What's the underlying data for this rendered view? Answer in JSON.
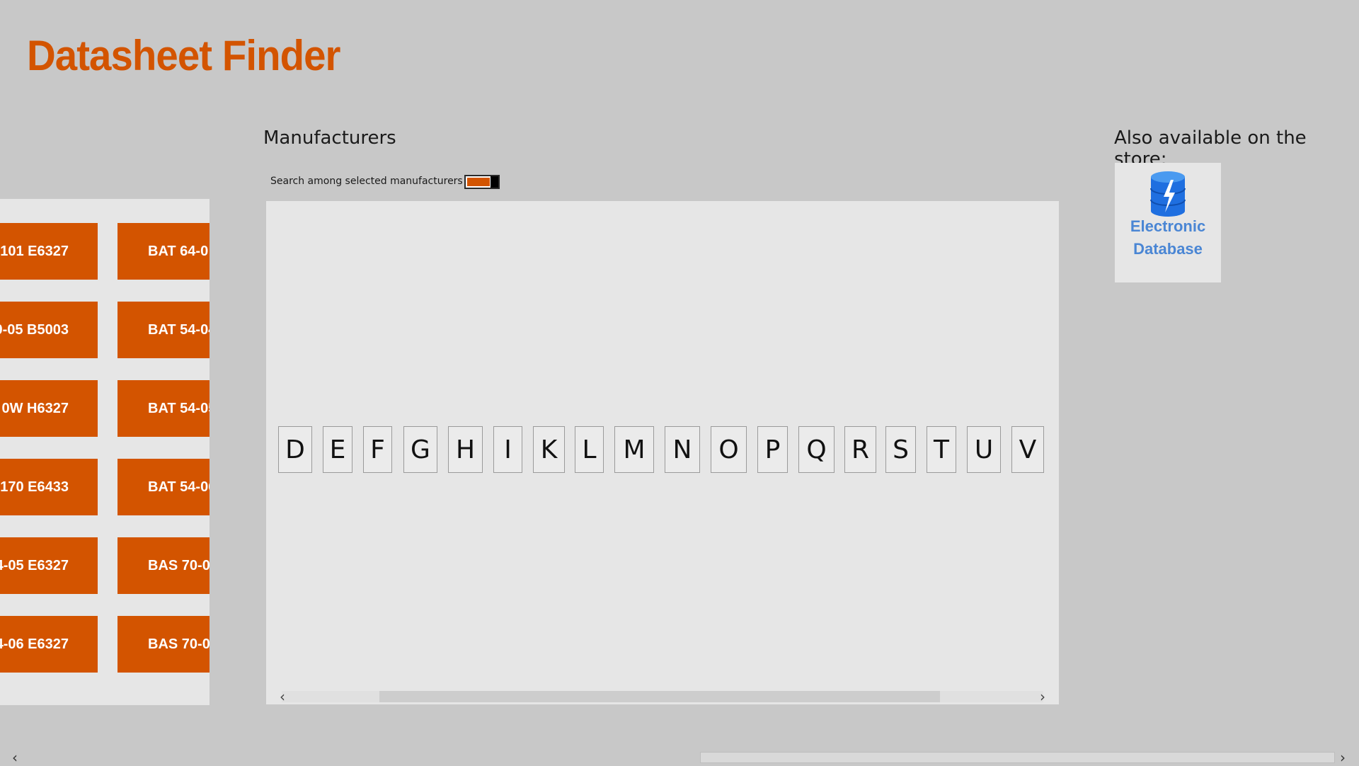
{
  "app": {
    "title": "Datasheet Finder"
  },
  "colors": {
    "accent": "#d35400",
    "store_text": "#4a86d4",
    "panel": "#e6e6e6",
    "background": "#c8c8c8"
  },
  "left_panel": {
    "col1": [
      "101 E6327",
      "0-05 B5003",
      "0W H6327",
      "170 E6433",
      "4-05 E6327",
      "4-06 E6327"
    ],
    "col2": [
      "BAT 64-0",
      "BAT 54-04",
      "BAT 54-05",
      "BAT 54-06",
      "BAS 70-0",
      "BAS 70-0"
    ]
  },
  "manufacturers": {
    "heading": "Manufacturers",
    "toggle_label": "Search among selected manufacturers",
    "toggle_on": true,
    "letters": [
      "D",
      "E",
      "F",
      "G",
      "H",
      "I",
      "K",
      "L",
      "M",
      "N",
      "O",
      "P",
      "Q",
      "R",
      "S",
      "T",
      "U",
      "V"
    ],
    "scroll_left_icon": "chevron-left-icon",
    "scroll_right_icon": "chevron-right-icon"
  },
  "store": {
    "heading": "Also available on the store:",
    "app_name_line1": "Electronic",
    "app_name_line2": "Database",
    "icon": "database-bolt-icon"
  }
}
